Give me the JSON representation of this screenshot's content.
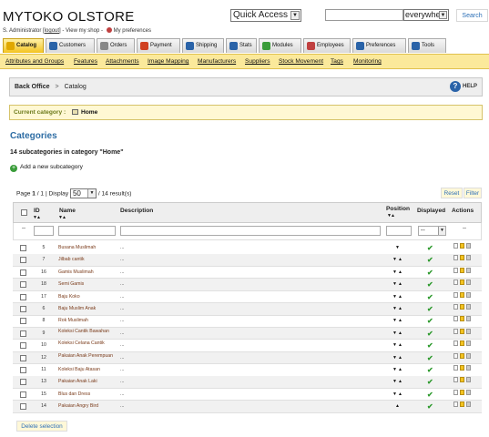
{
  "header": {
    "shop_name": "MYTOKO OLSTORE",
    "user_prefix": "S. Administrator [",
    "logout": "logout",
    "user_suffix": "] - View my shop -",
    "preferences": "My preferences",
    "quick_access": "Quick Access",
    "search_scope": "everywhe",
    "search_label": "Search"
  },
  "tabs": [
    {
      "label": "Catalog",
      "active": true,
      "color": "#e0a800"
    },
    {
      "label": "Customers",
      "color": "#2a63a8"
    },
    {
      "label": "Orders",
      "color": "#888888"
    },
    {
      "label": "Payment",
      "color": "#d04020"
    },
    {
      "label": "Shipping",
      "color": "#2a63a8"
    },
    {
      "label": "Stats",
      "color": "#2a63a8"
    },
    {
      "label": "Modules",
      "color": "#3a9c3a"
    },
    {
      "label": "Employees",
      "color": "#c04040"
    },
    {
      "label": "Preferences",
      "color": "#2a63a8"
    },
    {
      "label": "Tools",
      "color": "#2a63a8"
    }
  ],
  "subnav": [
    "Attributes and Groups",
    "Features",
    "Attachments",
    "Image Mapping",
    "Manufacturers",
    "Suppliers",
    "Stock Movement",
    "Tags",
    "Monitoring"
  ],
  "breadcrumb": {
    "root": "Back Office",
    "sep": ">",
    "current": "Catalog"
  },
  "help": "HELP",
  "current_category": {
    "label": "Current category :",
    "value": "Home"
  },
  "section_title": "Categories",
  "subcategory_count": "14 subcategories in category \"Home\"",
  "add_subcategory": "Add a new subcategory",
  "pager": {
    "page_label": "Page",
    "page": "1",
    "of": "/ 1",
    "display_label": "| Display",
    "per_page": "50",
    "results": "/ 14 result(s)"
  },
  "buttons": {
    "reset": "Reset",
    "filter": "Filter",
    "delete_selection": "Delete selection"
  },
  "table": {
    "headers": {
      "id": "ID",
      "name": "Name",
      "description": "Description",
      "position": "Position",
      "displayed": "Displayed",
      "actions": "Actions"
    },
    "filter_placeholder": "--",
    "displayed_filter": "--",
    "rows": [
      {
        "id": "5",
        "name": "Busana Muslimah",
        "desc": "...",
        "pos": "down"
      },
      {
        "id": "7",
        "name": "Jilbab cantik",
        "desc": "...",
        "pos": "both"
      },
      {
        "id": "16",
        "name": "Gamis Muslimah",
        "desc": "...",
        "pos": "both"
      },
      {
        "id": "18",
        "name": "Semi Gamis",
        "desc": "...",
        "pos": "both"
      },
      {
        "id": "17",
        "name": "Baju Koko",
        "desc": "...",
        "pos": "both"
      },
      {
        "id": "6",
        "name": "Baju Muslim Anak",
        "desc": "...",
        "pos": "both"
      },
      {
        "id": "8",
        "name": "Rok Muslimah",
        "desc": "...",
        "pos": "both"
      },
      {
        "id": "9",
        "name": "Koleksi Cantik Bawahan",
        "desc": "...",
        "pos": "both"
      },
      {
        "id": "10",
        "name": "Koleksi Celana Cantik",
        "desc": "...",
        "pos": "both"
      },
      {
        "id": "12",
        "name": "Pakaian Anak Perempuan",
        "desc": "...",
        "pos": "both"
      },
      {
        "id": "11",
        "name": "Koleksi Baju Atasan",
        "desc": "...",
        "pos": "both"
      },
      {
        "id": "13",
        "name": "Pakaian Anak Laki",
        "desc": "...",
        "pos": "both"
      },
      {
        "id": "15",
        "name": "Blus dan Dress",
        "desc": "...",
        "pos": "both"
      },
      {
        "id": "14",
        "name": "Pakaian Angry Bird",
        "desc": "...",
        "pos": "up"
      }
    ]
  }
}
